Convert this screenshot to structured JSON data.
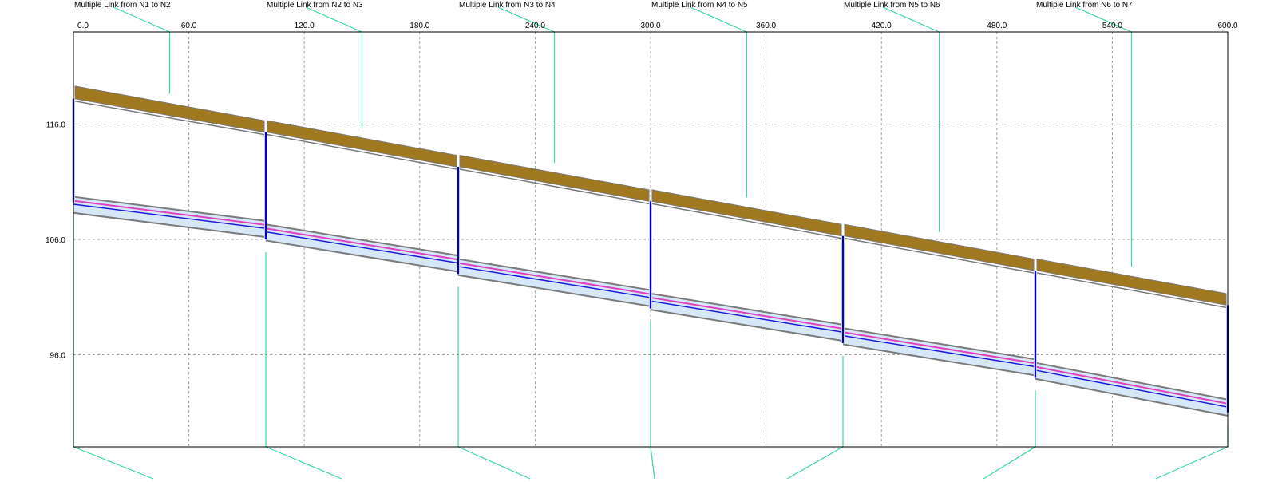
{
  "chart_data": {
    "type": "profile",
    "title": "",
    "xlabel": "",
    "ylabel": "",
    "xlim": [
      0,
      600
    ],
    "ylim": [
      88,
      124
    ],
    "grid": true,
    "x_ticks": [
      "0.0",
      "60.0",
      "120.0",
      "180.0",
      "240.0",
      "300.0",
      "360.0",
      "420.0",
      "480.0",
      "540.0",
      "600.0"
    ],
    "y_ticks": [
      "116.0",
      "106.0",
      "96.0"
    ],
    "x_tick_values": [
      0,
      60,
      120,
      180,
      240,
      300,
      360,
      420,
      480,
      540,
      600
    ],
    "y_tick_values": [
      116,
      106,
      96
    ],
    "nodes": [
      {
        "station": 0,
        "ground": 119.3,
        "top": 118.2,
        "invert": 109.2
      },
      {
        "station": 100,
        "ground": 116.3,
        "top": 115.3,
        "invert": 106.0
      },
      {
        "station": 200,
        "ground": 113.3,
        "top": 112.3,
        "invert": 103.0
      },
      {
        "station": 300,
        "ground": 110.3,
        "top": 109.3,
        "invert": 100.0
      },
      {
        "station": 400,
        "ground": 107.3,
        "top": 106.3,
        "invert": 97.0
      },
      {
        "station": 500,
        "ground": 104.3,
        "top": 103.3,
        "invert": 94.0
      },
      {
        "station": 600,
        "ground": 101.3,
        "top": 100.3,
        "invert": 91.0
      }
    ],
    "links": [
      {
        "label": "Multiple Link from N1 to N2",
        "from_station": 0,
        "to_station": 100,
        "upstream_invert": 109.2,
        "downstream_invert": 107.1,
        "diameter": 1.4
      },
      {
        "label": "Multiple Link from N2 to N3",
        "from_station": 100,
        "to_station": 200,
        "upstream_invert": 106.8,
        "downstream_invert": 104.1,
        "diameter": 1.4
      },
      {
        "label": "Multiple Link from N3 to N4",
        "from_station": 200,
        "to_station": 300,
        "upstream_invert": 103.8,
        "downstream_invert": 101.1,
        "diameter": 1.4
      },
      {
        "label": "Multiple Link from N4 to N5",
        "from_station": 300,
        "to_station": 400,
        "upstream_invert": 100.8,
        "downstream_invert": 98.1,
        "diameter": 1.4
      },
      {
        "label": "Multiple Link from N5 to N6",
        "from_station": 400,
        "to_station": 500,
        "upstream_invert": 97.8,
        "downstream_invert": 95.1,
        "diameter": 1.4
      },
      {
        "label": "Multiple Link from N6 to N7",
        "from_station": 500,
        "to_station": 600,
        "upstream_invert": 94.8,
        "downstream_invert": 91.6,
        "diameter": 1.4
      }
    ],
    "colors": {
      "ground": "#a07820",
      "node_wall": "#0000c8",
      "water_line": "#e040c0",
      "hydraulic_line": "#1a1adc",
      "pipe_outline": "#7a7a7a",
      "pipe_fill": "#d6e8f8",
      "leader": "#3ad9a0",
      "grid": "#a0a0a0",
      "axes": "#000000"
    }
  }
}
